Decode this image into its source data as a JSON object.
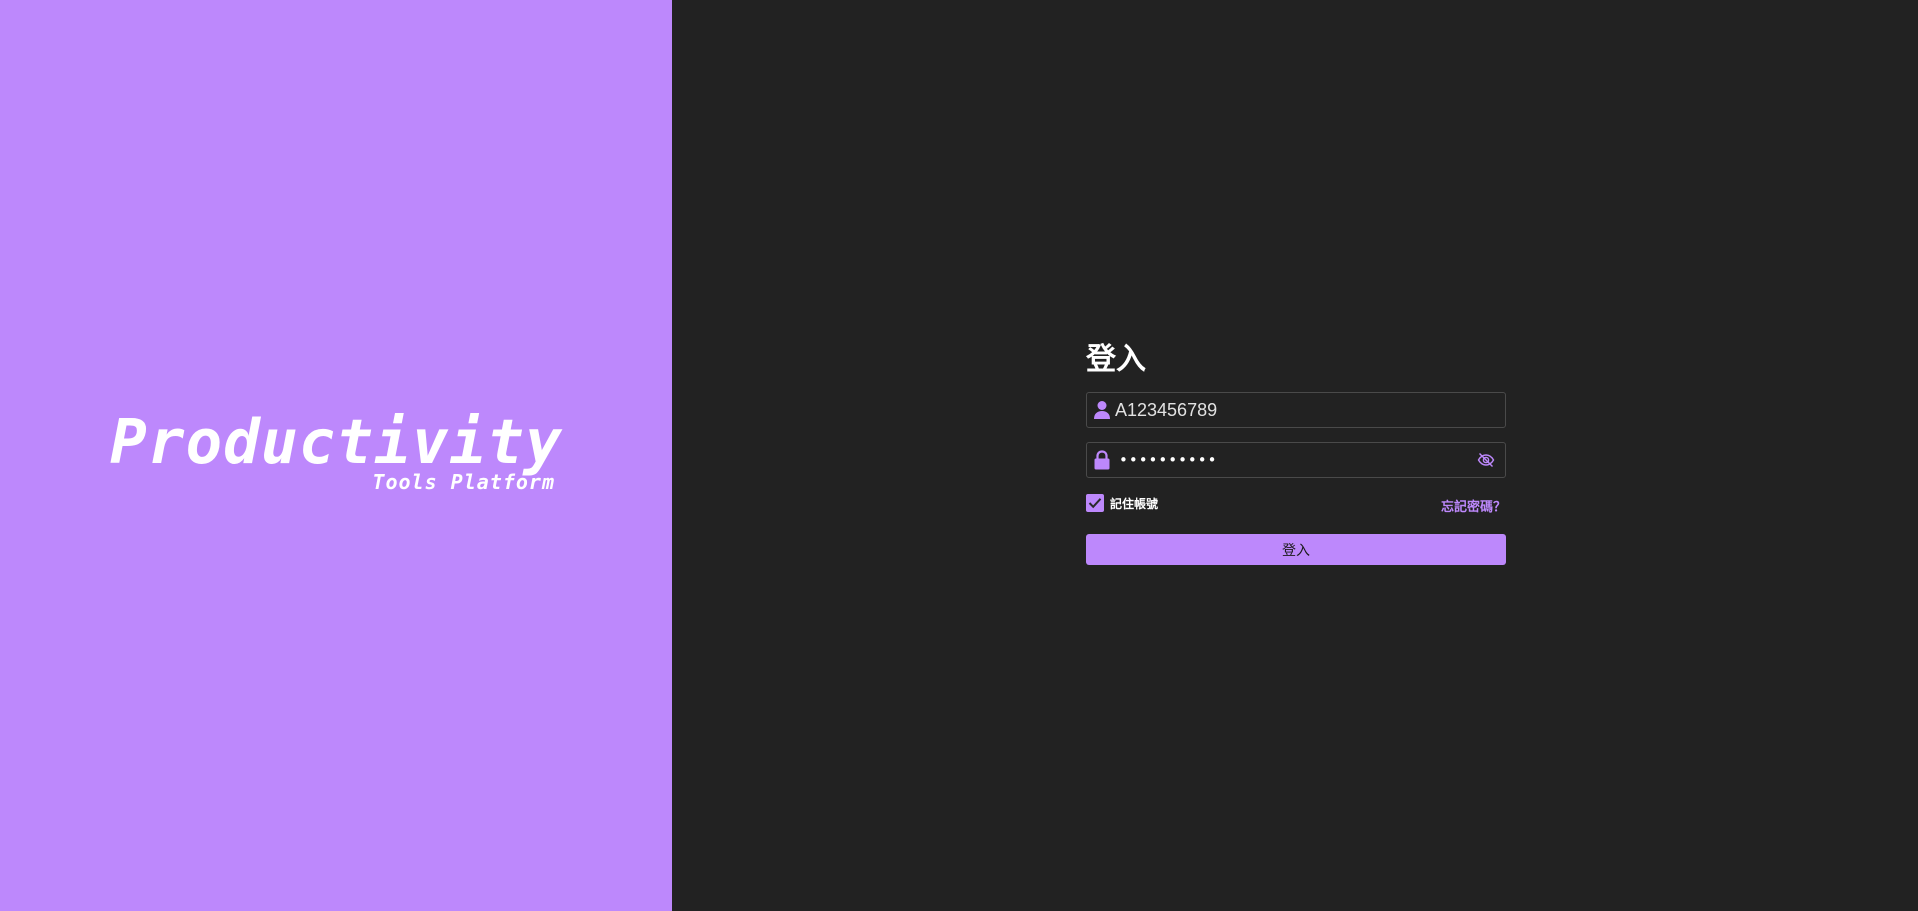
{
  "brand": {
    "title": "Productivity",
    "subtitle": "Tools Platform"
  },
  "login": {
    "heading": "登入",
    "username": {
      "value": "A123456789",
      "icon": "user-icon"
    },
    "password": {
      "masked_value": "••••••••••",
      "icon": "lock-icon",
      "toggle_icon": "eye-slash-icon"
    },
    "remember_label": "記住帳號",
    "remember_checked": true,
    "forgot_label": "忘記密碼？",
    "submit_label": "登入"
  },
  "colors": {
    "accent": "#bd88fc",
    "panel_background": "#222222",
    "field_border": "#4a4a4a",
    "text": "#ffffff"
  }
}
